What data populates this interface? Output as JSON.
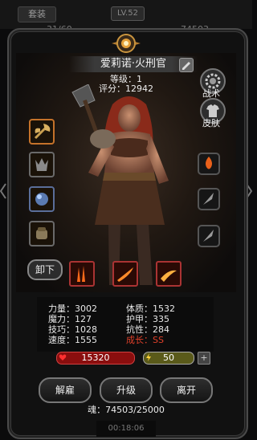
{
  "topbar": {
    "tab_label": "套装",
    "level_label": "LV.52",
    "left_value": "31/60",
    "right_value": "74503"
  },
  "hero": {
    "name": "爱莉诺·火刑官",
    "level_text": "等级：1",
    "score_text": "评分：12942"
  },
  "side_buttons": {
    "tactics_label": "战术",
    "skin_label": "皮肤"
  },
  "equipment": {
    "unequip_label": "卸下",
    "slots": [
      "axe-icon",
      "wolf-icon",
      "ice-orb-icon",
      "gauntlet-icon"
    ]
  },
  "skills": [
    "flame-skill-1-icon",
    "flame-skill-2-icon",
    "flame-skill-3-icon"
  ],
  "right_slots": [
    "fire-rune-icon",
    "feather-icon",
    "feather-icon"
  ],
  "stats": {
    "strength": "力量：3002",
    "magic": "魔力：127",
    "skill": "技巧：1028",
    "speed": "速度：1555",
    "constitution": "体质：1532",
    "armor": "护甲：335",
    "resist": "抗性：284",
    "growth": "成长：SS"
  },
  "bars": {
    "hp": "15320",
    "mp": "50",
    "plus": "+"
  },
  "actions": {
    "dismiss": "解雇",
    "upgrade": "升级",
    "leave": "离开"
  },
  "soul_text": "魂：74503/25000",
  "bottom_time": "00:18:06",
  "colors": {
    "accent_orange": "#c4722a",
    "hp_red": "#8a0e0e",
    "growth_red": "#e0402a"
  }
}
